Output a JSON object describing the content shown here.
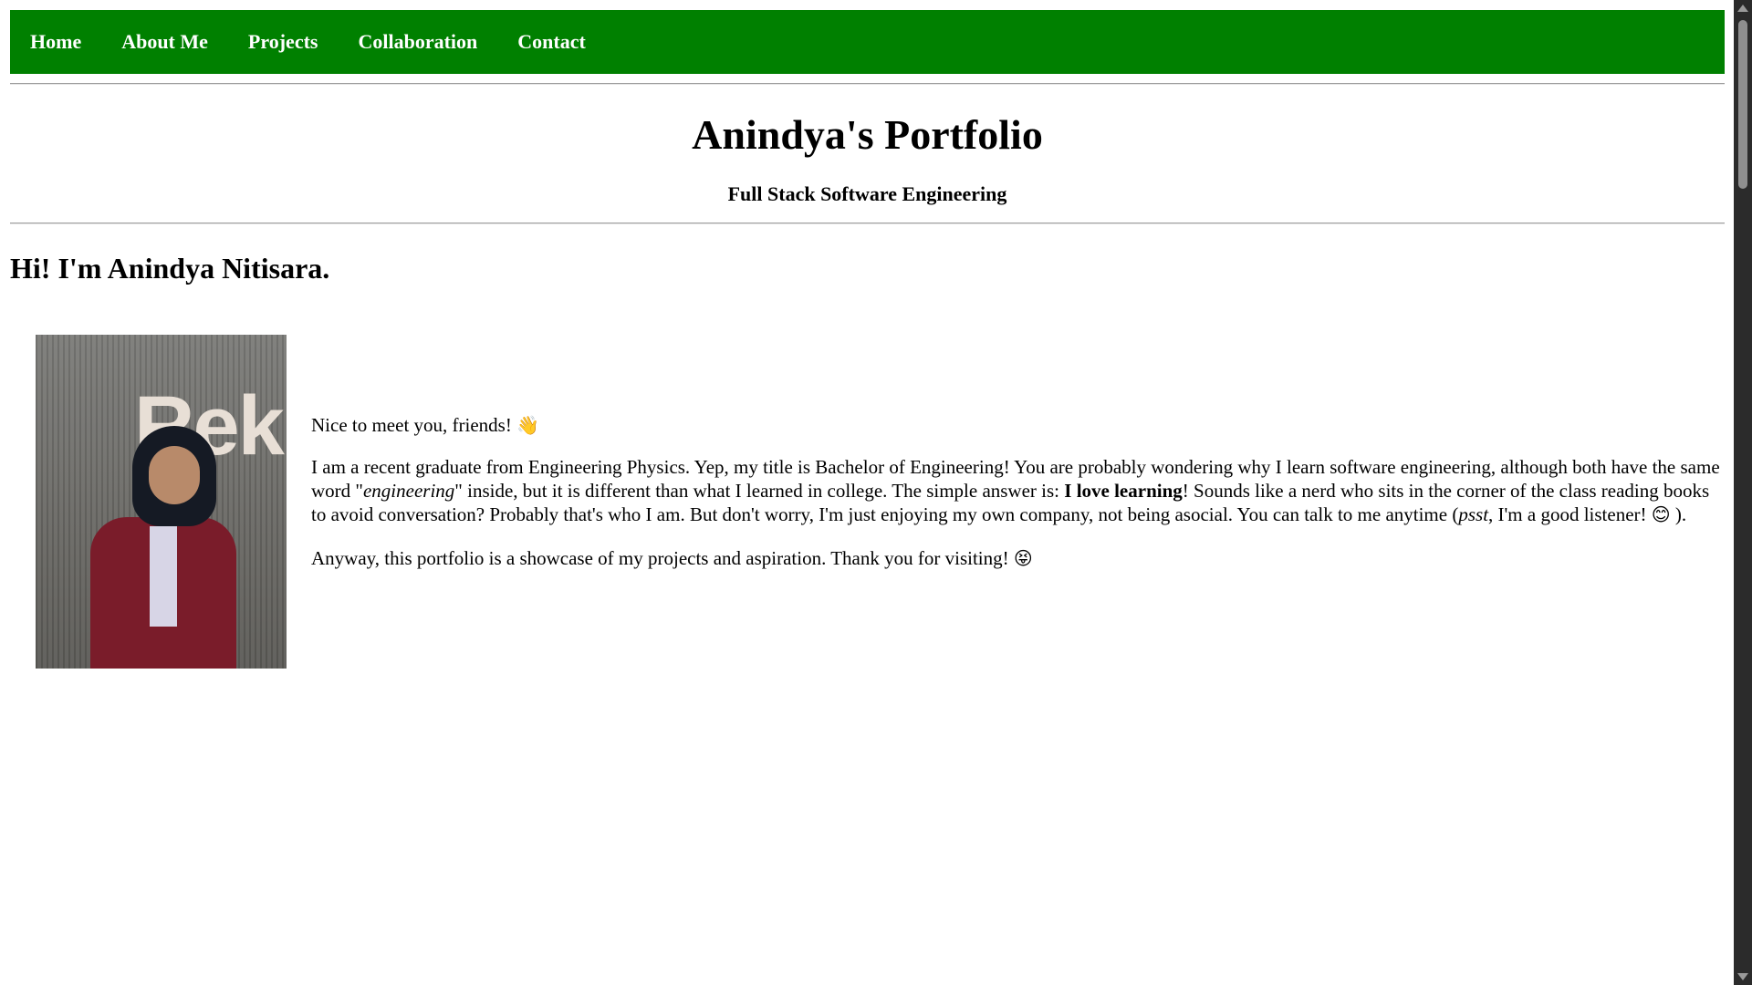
{
  "nav": {
    "items": [
      "Home",
      "About Me",
      "Projects",
      "Collaboration",
      "Contact"
    ]
  },
  "header": {
    "title": "Anindya's Portfolio",
    "subtitle": "Full Stack Software Engineering"
  },
  "main": {
    "greeting": "Hi! I'm Anindya Nitisara.",
    "photo_sign": "Rek",
    "intro": {
      "line1": "Nice to meet you, friends!",
      "line1_emoji": "👋",
      "p2_a": "I am a recent graduate from Engineering Physics. Yep, my title is Bachelor of Engineering! You are probably wondering why I learn software engineering, although both have the same word \"",
      "p2_em": "engineering",
      "p2_b": "\" inside, but it is different than what I learned in college. The simple answer is: ",
      "p2_strong": "I love learning",
      "p2_c": "! Sounds like a nerd who sits in the corner of the class reading books to avoid conversation? Probably that's who I am. But don't worry, I'm just enjoying my own company, not being asocial. You can talk to me anytime (",
      "p2_em2": "psst",
      "p2_d": ", I'm a good listener!",
      "p2_emoji": "😊",
      "p2_end": ").",
      "p3": "Anyway, this portfolio is a showcase of my projects and aspiration. Thank you for visiting!",
      "p3_emoji": "😝"
    }
  },
  "colors": {
    "nav_bg": "#008000",
    "nav_text": "#ffffff"
  }
}
